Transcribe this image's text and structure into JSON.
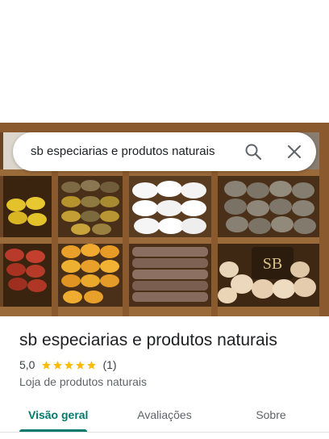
{
  "search": {
    "query": "sb especiarias e produtos naturais",
    "search_icon": "search-icon",
    "clear_icon": "close-icon"
  },
  "place": {
    "name": "sb especiarias e produtos naturais",
    "rating": "5,0",
    "stars": 5,
    "review_count": "(1)",
    "category": "Loja de produtos naturais"
  },
  "tabs": [
    {
      "label": "Visão geral",
      "active": true
    },
    {
      "label": "Avaliações",
      "active": false
    },
    {
      "label": "Sobre",
      "active": false
    }
  ],
  "photo": {
    "shelf_label": "SB"
  },
  "colors": {
    "accent": "#00796b",
    "star": "#fbbc04"
  }
}
